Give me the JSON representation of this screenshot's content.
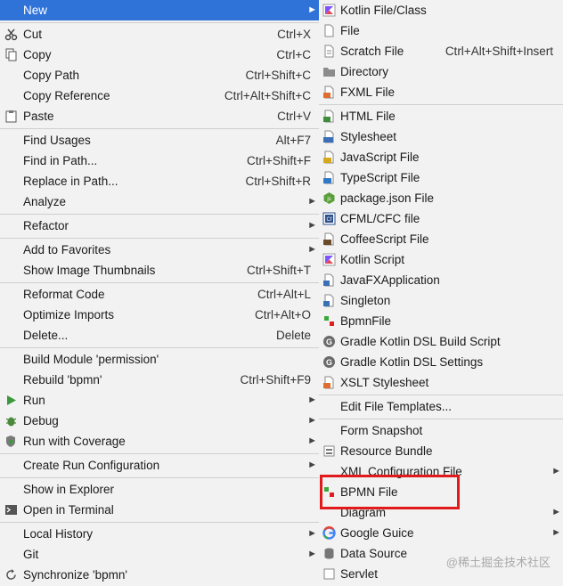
{
  "left_menu": {
    "new": "New",
    "cut": {
      "label": "Cut",
      "shortcut": "Ctrl+X"
    },
    "copy": {
      "label": "Copy",
      "shortcut": "Ctrl+C"
    },
    "copy_path": {
      "label": "Copy Path",
      "shortcut": "Ctrl+Shift+C"
    },
    "copy_reference": {
      "label": "Copy Reference",
      "shortcut": "Ctrl+Alt+Shift+C"
    },
    "paste": {
      "label": "Paste",
      "shortcut": "Ctrl+V"
    },
    "find_usages": {
      "label": "Find Usages",
      "shortcut": "Alt+F7"
    },
    "find_in_path": {
      "label": "Find in Path...",
      "shortcut": "Ctrl+Shift+F"
    },
    "replace_in_path": {
      "label": "Replace in Path...",
      "shortcut": "Ctrl+Shift+R"
    },
    "analyze": "Analyze",
    "refactor": "Refactor",
    "add_to_favorites": "Add to Favorites",
    "show_image_thumbnails": {
      "label": "Show Image Thumbnails",
      "shortcut": "Ctrl+Shift+T"
    },
    "reformat_code": {
      "label": "Reformat Code",
      "shortcut": "Ctrl+Alt+L"
    },
    "optimize_imports": {
      "label": "Optimize Imports",
      "shortcut": "Ctrl+Alt+O"
    },
    "delete": {
      "label": "Delete...",
      "shortcut": "Delete"
    },
    "build_module": "Build Module 'permission'",
    "rebuild": {
      "label": "Rebuild 'bpmn'",
      "shortcut": "Ctrl+Shift+F9"
    },
    "run": "Run",
    "debug": "Debug",
    "run_with_coverage": "Run with Coverage",
    "create_run_configuration": "Create Run Configuration",
    "show_in_explorer": "Show in Explorer",
    "open_in_terminal": "Open in Terminal",
    "local_history": "Local History",
    "git": "Git",
    "synchronize": "Synchronize 'bpmn'"
  },
  "right_menu": {
    "kotlin_file_class": "Kotlin File/Class",
    "file": "File",
    "scratch_file": {
      "label": "Scratch File",
      "shortcut": "Ctrl+Alt+Shift+Insert"
    },
    "directory": "Directory",
    "fxml_file": "FXML File",
    "html_file": "HTML File",
    "stylesheet": "Stylesheet",
    "javascript_file": "JavaScript File",
    "typescript_file": "TypeScript File",
    "package_json_file": "package.json File",
    "cfml_cfc_file": "CFML/CFC file",
    "coffeescript_file": "CoffeeScript File",
    "kotlin_script": "Kotlin Script",
    "javafx_application": "JavaFXApplication",
    "singleton": "Singleton",
    "bpmnfile": "BpmnFile",
    "gradle_kotlin_dsl_build_script": "Gradle Kotlin DSL Build Script",
    "gradle_kotlin_dsl_settings": "Gradle Kotlin DSL Settings",
    "xslt_stylesheet": "XSLT Stylesheet",
    "edit_file_templates": "Edit File Templates...",
    "form_snapshot": "Form Snapshot",
    "resource_bundle": "Resource Bundle",
    "xml_configuration_file": "XML Configuration File",
    "bpmn_file": "BPMN File",
    "diagram": "Diagram",
    "google_guice": "Google Guice",
    "data_source": "Data Source",
    "servlet": "Servlet"
  },
  "watermark": "@稀土掘金技术社区",
  "colors": {
    "selection": "#2f73d9",
    "highlight_box": "#e11b1b",
    "menu_bg": "#f2f2f2"
  }
}
